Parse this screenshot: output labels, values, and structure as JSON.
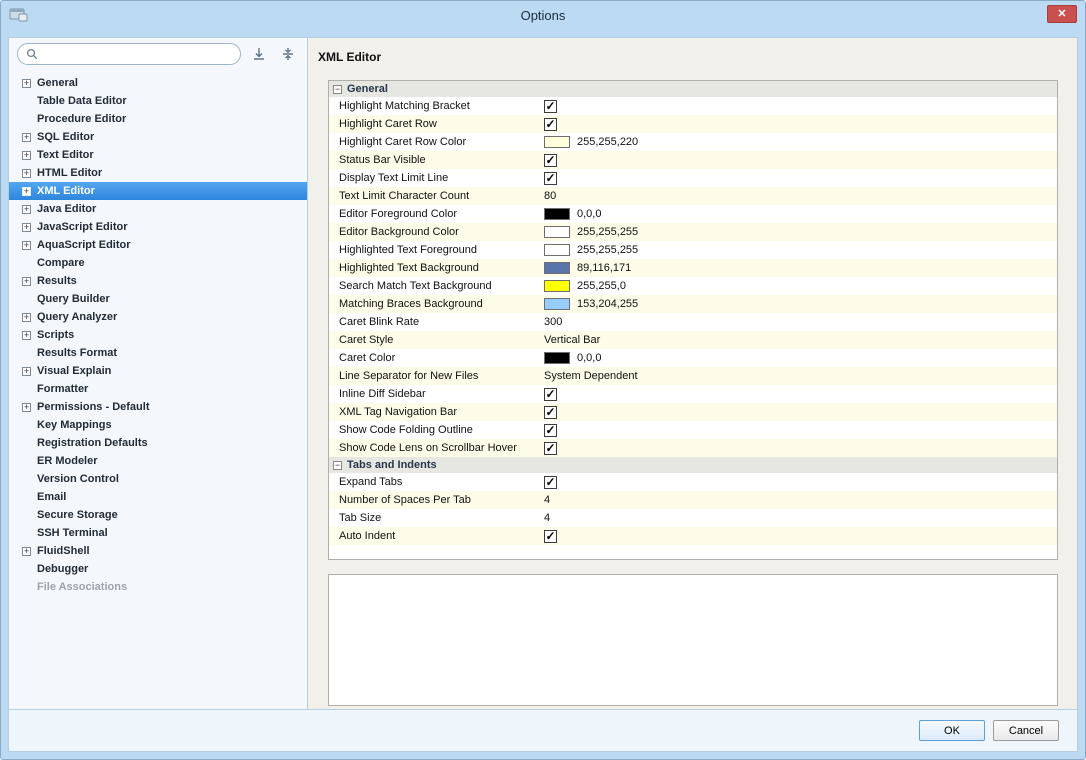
{
  "window": {
    "title": "Options"
  },
  "glyphs": {
    "close": "✕",
    "expand": "+",
    "collapse": "−",
    "check": "✓"
  },
  "colors": {
    "selection_blue": "#2d85dc",
    "close_red": "#c9504e",
    "row_alt": "#fcfce8"
  },
  "sidebar": {
    "search": {
      "value": "",
      "placeholder": ""
    },
    "items": [
      {
        "label": "General",
        "expandable": true
      },
      {
        "label": "Table Data Editor"
      },
      {
        "label": "Procedure Editor"
      },
      {
        "label": "SQL Editor",
        "expandable": true
      },
      {
        "label": "Text Editor",
        "expandable": true
      },
      {
        "label": "HTML Editor",
        "expandable": true
      },
      {
        "label": "XML Editor",
        "expandable": true,
        "selected": true
      },
      {
        "label": "Java Editor",
        "expandable": true
      },
      {
        "label": "JavaScript Editor",
        "expandable": true
      },
      {
        "label": "AquaScript Editor",
        "expandable": true
      },
      {
        "label": "Compare"
      },
      {
        "label": "Results",
        "expandable": true
      },
      {
        "label": "Query Builder"
      },
      {
        "label": "Query Analyzer",
        "expandable": true
      },
      {
        "label": "Scripts",
        "expandable": true
      },
      {
        "label": "Results Format"
      },
      {
        "label": "Visual Explain",
        "expandable": true
      },
      {
        "label": "Formatter"
      },
      {
        "label": "Permissions - Default",
        "expandable": true
      },
      {
        "label": "Key Mappings"
      },
      {
        "label": "Registration Defaults"
      },
      {
        "label": "ER Modeler"
      },
      {
        "label": "Version Control"
      },
      {
        "label": "Email"
      },
      {
        "label": "Secure Storage"
      },
      {
        "label": "SSH Terminal"
      },
      {
        "label": "FluidShell",
        "expandable": true
      },
      {
        "label": "Debugger"
      },
      {
        "label": "File Associations",
        "disabled": true
      }
    ]
  },
  "panel": {
    "title": "XML Editor",
    "sections": [
      {
        "title": "General",
        "rows": [
          {
            "label": "Highlight Matching Bracket",
            "type": "checkbox",
            "checked": true
          },
          {
            "label": "Highlight Caret Row",
            "type": "checkbox",
            "checked": true
          },
          {
            "label": "Highlight Caret Row Color",
            "type": "color",
            "swatch": "#FFFFDC",
            "value": "255,255,220"
          },
          {
            "label": "Status Bar Visible",
            "type": "checkbox",
            "checked": true
          },
          {
            "label": "Display Text Limit Line",
            "type": "checkbox",
            "checked": true
          },
          {
            "label": "Text Limit Character Count",
            "type": "text",
            "value": "80"
          },
          {
            "label": "Editor Foreground Color",
            "type": "color",
            "swatch": "#000000",
            "value": "0,0,0"
          },
          {
            "label": "Editor Background Color",
            "type": "color",
            "swatch": "#FFFFFF",
            "value": "255,255,255"
          },
          {
            "label": "Highlighted Text Foreground",
            "type": "color",
            "swatch": "#FFFFFF",
            "value": "255,255,255"
          },
          {
            "label": "Highlighted Text Background",
            "type": "color",
            "swatch": "#5974AB",
            "value": "89,116,171"
          },
          {
            "label": "Search Match Text Background",
            "type": "color",
            "swatch": "#FFFF00",
            "value": "255,255,0"
          },
          {
            "label": "Matching Braces Background",
            "type": "color",
            "swatch": "#99CCFF",
            "value": "153,204,255"
          },
          {
            "label": "Caret Blink Rate",
            "type": "text",
            "value": "300"
          },
          {
            "label": "Caret Style",
            "type": "text",
            "value": "Vertical Bar"
          },
          {
            "label": "Caret Color",
            "type": "color",
            "swatch": "#000000",
            "value": "0,0,0"
          },
          {
            "label": "Line Separator for New Files",
            "type": "text",
            "value": "System Dependent"
          },
          {
            "label": "Inline Diff Sidebar",
            "type": "checkbox",
            "checked": true
          },
          {
            "label": "XML Tag Navigation Bar",
            "type": "checkbox",
            "checked": true
          },
          {
            "label": "Show Code Folding Outline",
            "type": "checkbox",
            "checked": true
          },
          {
            "label": "Show Code Lens on Scrollbar Hover",
            "type": "checkbox",
            "checked": true
          }
        ]
      },
      {
        "title": "Tabs and Indents",
        "rows": [
          {
            "label": "Expand Tabs",
            "type": "checkbox",
            "checked": true
          },
          {
            "label": "Number of Spaces Per Tab",
            "type": "text",
            "value": "4"
          },
          {
            "label": "Tab Size",
            "type": "text",
            "value": "4"
          },
          {
            "label": "Auto Indent",
            "type": "checkbox",
            "checked": true
          }
        ]
      }
    ]
  },
  "footer": {
    "ok_label": "OK",
    "cancel_label": "Cancel"
  }
}
